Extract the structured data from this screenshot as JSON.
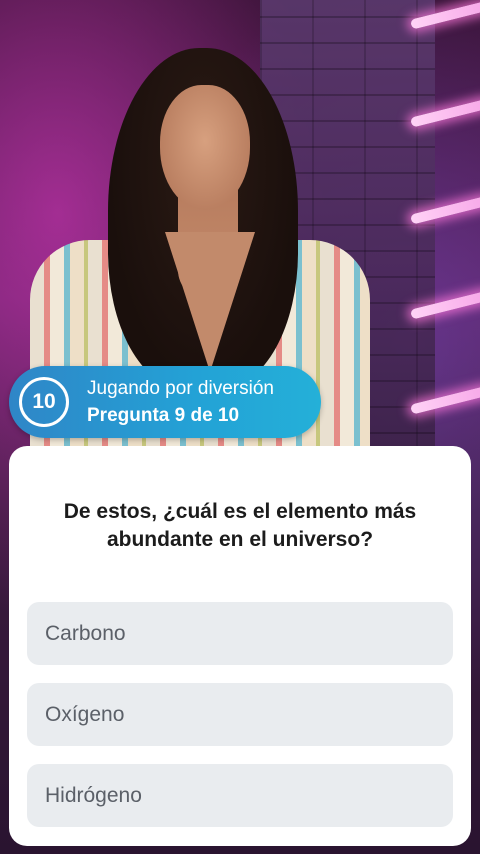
{
  "badge": {
    "timer": "10",
    "title": "Jugando por diversión",
    "subtitle": "Pregunta 9 de 10"
  },
  "question": "De estos, ¿cuál es el elemento más abundante en el universo?",
  "options": [
    {
      "label": "Carbono"
    },
    {
      "label": "Oxígeno"
    },
    {
      "label": "Hidrógeno"
    }
  ],
  "colors": {
    "badge_start": "#2f86c7",
    "badge_end": "#24b0d8",
    "option_bg": "#e9ecef"
  }
}
